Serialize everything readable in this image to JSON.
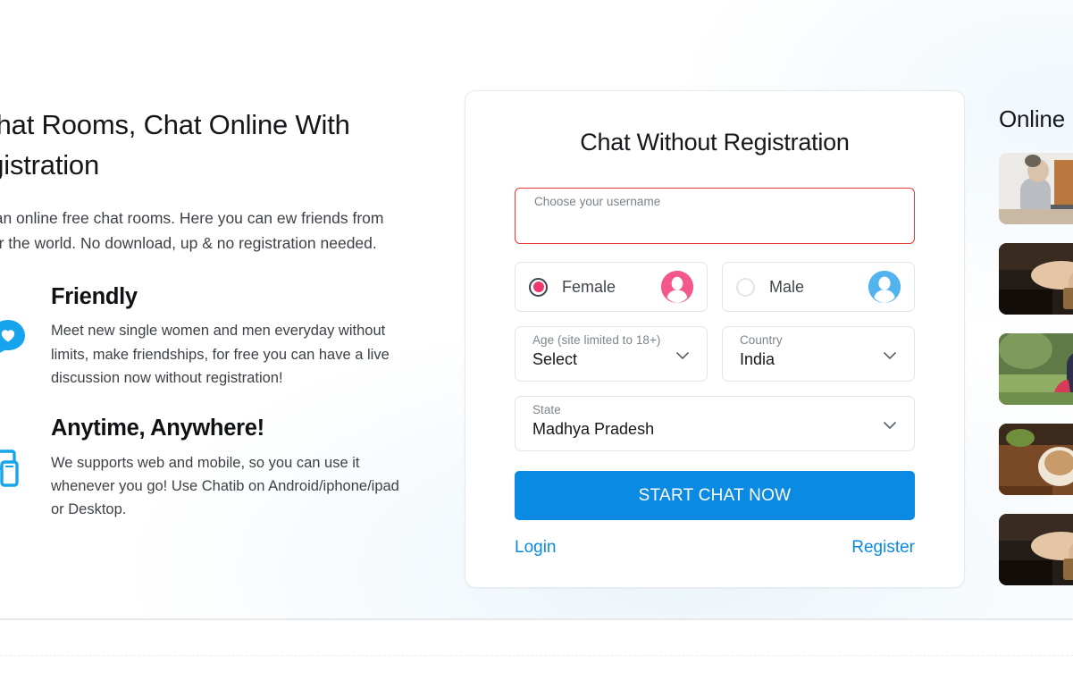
{
  "hero": {
    "title": "e Chat Rooms, Chat Online With\nRegistration",
    "subtitle": ".us is an online free chat rooms. Here you can\new friends from all over the world. No download,\nup & no registration needed."
  },
  "features": [
    {
      "icon": "chat-heart-icon",
      "title": "Friendly",
      "text": "Meet new single women and men everyday without limits, make friendships, for free you can have a live discussion now without registration!"
    },
    {
      "icon": "devices-icon",
      "title": "Anytime, Anywhere!",
      "text": "We supports web and mobile, so you can use it whenever you go! Use Chatib on Android/iphone/ipad or Desktop."
    }
  ],
  "form": {
    "title": "Chat Without Registration",
    "username": {
      "label": "Choose your username",
      "value": "",
      "placeholder": "",
      "error": true,
      "error_color": "#e53935"
    },
    "gender": {
      "selected": "Female",
      "options": [
        {
          "label": "Female",
          "checked": true,
          "avatar": "female-avatar-icon",
          "color": "#f4588a"
        },
        {
          "label": "Male",
          "checked": false,
          "avatar": "male-avatar-icon",
          "color": "#52b3ef"
        }
      ],
      "radio_fill_color": "#f0376d"
    },
    "age": {
      "label": "Age (site limited to 18+)",
      "value": "Select"
    },
    "country": {
      "label": "Country",
      "value": "India"
    },
    "state": {
      "label": "State",
      "value": "Madhya Pradesh"
    },
    "submit_label": "START CHAT NOW",
    "submit_color": "#0b8ae3",
    "login_label": "Login",
    "register_label": "Register",
    "link_color": "#0b8ae3"
  },
  "sidebar": {
    "title": "Online",
    "thumbnails": [
      {
        "name": "thumbnail-woman-at-desk"
      },
      {
        "name": "thumbnail-hands-coffee-dark"
      },
      {
        "name": "thumbnail-woman-outdoors"
      },
      {
        "name": "thumbnail-coffee-cup-hands"
      },
      {
        "name": "thumbnail-hands-coffee-dark-2"
      }
    ]
  }
}
